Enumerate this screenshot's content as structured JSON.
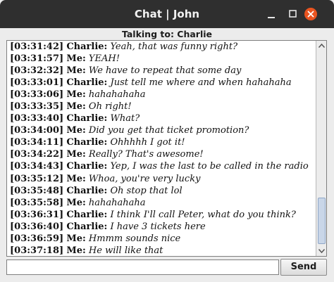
{
  "window": {
    "title": "Chat | John",
    "controls": [
      "minimize-icon",
      "maximize-icon",
      "close-icon"
    ],
    "accent_close": "#e95420"
  },
  "header": {
    "talking_to": "Talking to: Charlie"
  },
  "messages": [
    {
      "time": "[03:31:42]",
      "sender": "Charlie:",
      "text": "Yeah, that was funny right?"
    },
    {
      "time": "[03:31:57]",
      "sender": "Me:",
      "text": "YEAH!"
    },
    {
      "time": "[03:32:32]",
      "sender": "Me:",
      "text": "We have to repeat that some day"
    },
    {
      "time": "[03:33:01]",
      "sender": "Charlie:",
      "text": "Just tell me where and when hahahaha"
    },
    {
      "time": "[03:33:06]",
      "sender": "Me:",
      "text": "hahahahaha"
    },
    {
      "time": "[03:33:35]",
      "sender": "Me:",
      "text": "Oh right!"
    },
    {
      "time": "[03:33:40]",
      "sender": "Charlie:",
      "text": "What?"
    },
    {
      "time": "[03:34:00]",
      "sender": "Me:",
      "text": "Did you get that ticket promotion?"
    },
    {
      "time": "[03:34:11]",
      "sender": "Charlie:",
      "text": "Ohhhhh I got it!"
    },
    {
      "time": "[03:34:22]",
      "sender": "Me:",
      "text": "Really? That's awesome!"
    },
    {
      "time": "[03:34:43]",
      "sender": "Charlie:",
      "text": "Yep, I was the last to be called in the radio"
    },
    {
      "time": "[03:35:12]",
      "sender": "Me:",
      "text": "Whoa, you're very lucky"
    },
    {
      "time": "[03:35:48]",
      "sender": "Charlie:",
      "text": "Oh stop that lol"
    },
    {
      "time": "[03:35:58]",
      "sender": "Me:",
      "text": "hahahahaha"
    },
    {
      "time": "[03:36:31]",
      "sender": "Charlie:",
      "text": "I think I'll call Peter, what do you think?"
    },
    {
      "time": "[03:36:40]",
      "sender": "Charlie:",
      "text": "I have 3 tickets here"
    },
    {
      "time": "[03:36:59]",
      "sender": "Me:",
      "text": "Hmmm sounds nice"
    },
    {
      "time": "[03:37:18]",
      "sender": "Me:",
      "text": "He will like that"
    }
  ],
  "input": {
    "value": "",
    "placeholder": ""
  },
  "send_label": "Send",
  "scrollbar": {
    "position_fraction": 1.0
  }
}
